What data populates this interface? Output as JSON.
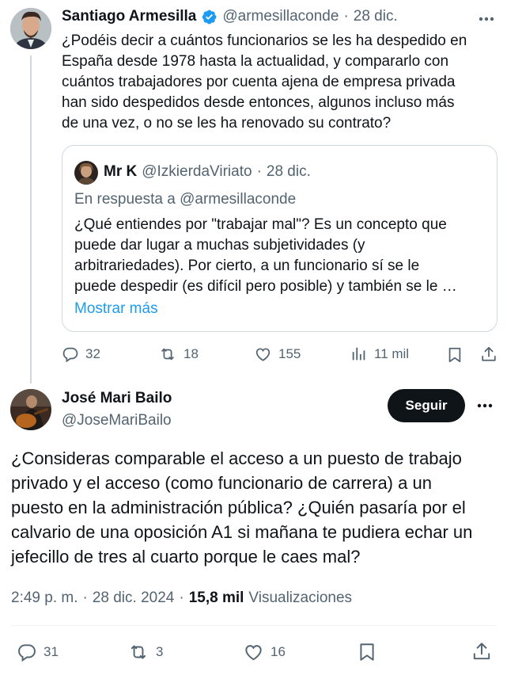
{
  "parent_tweet": {
    "author_name": "Santiago Armesilla",
    "handle": "@armesillaconde",
    "separator": "·",
    "date": "28 dic.",
    "text": "¿Podéis decir a cuántos funcionarios se les ha despedido en\nEspaña desde 1978 hasta la actualidad, y compararlo con\ncuántos trabajadores por cuenta ajena de empresa privada\nhan sido despedidos desde entonces, algunos incluso más\nde una vez, o no se les ha renovado su contrato?",
    "quote": {
      "author_name": "Mr K",
      "handle": "@IzkierdaViriato",
      "separator": "·",
      "date": "28 dic.",
      "reply_to_label": "En respuesta a ",
      "reply_to_handle": "@armesillaconde",
      "text": "¿Qué entiendes por \"trabajar mal\"? Es un concepto que\npuede dar lugar a muchas subjetividades (y\narbitrariedades). Por cierto, a un funcionario sí se le\npuede despedir (es difícil pero posible) y también se le …",
      "show_more": "Mostrar más"
    },
    "stats": {
      "replies": "32",
      "reposts": "18",
      "likes": "155",
      "views": "11 mil"
    }
  },
  "main_tweet": {
    "author_name": "José Mari Bailo",
    "handle": "@JoseMariBailo",
    "follow_label": "Seguir",
    "text": "¿Consideras comparable el acceso a un puesto de trabajo\nprivado y el acceso (como funcionario de carrera) a un\npuesto en la administración pública? ¿Quién pasaría por el\ncalvario de una oposición A1 si mañana te pudiera echar un\njefecillo de tres al cuarto porque le caes mal?",
    "time": "2:49 p. m.",
    "separator": "·",
    "date": "28 dic. 2024",
    "separator2": "·",
    "views_count": "15,8 mil",
    "views_label": "Visualizaciones",
    "stats": {
      "replies": "31",
      "reposts": "3",
      "likes": "16"
    }
  },
  "colors": {
    "accent": "#1d9bf0",
    "text": "#0f1419",
    "muted": "#536471",
    "verified": "#1d9bf0"
  },
  "icons": [
    "more-icon",
    "verified-icon",
    "reply-icon",
    "repost-icon",
    "like-icon",
    "views-icon",
    "bookmark-icon",
    "share-icon"
  ]
}
